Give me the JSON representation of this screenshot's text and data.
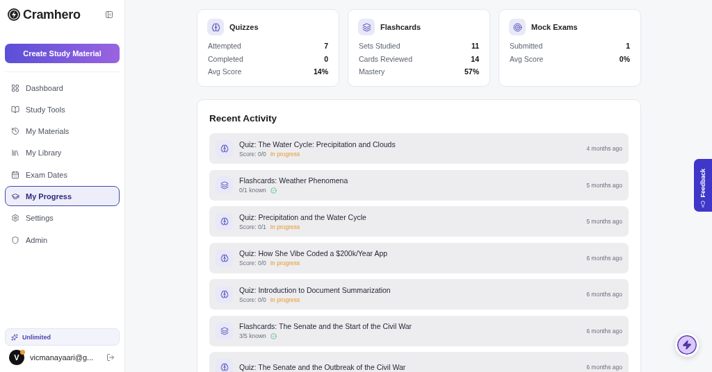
{
  "sidebar": {
    "brand": "Cramhero",
    "create_button": "Create Study Material",
    "items": [
      {
        "label": "Dashboard",
        "selected": false
      },
      {
        "label": "Study Tools",
        "selected": false
      },
      {
        "label": "My Materials",
        "selected": false
      },
      {
        "label": "My Library",
        "selected": false
      },
      {
        "label": "Exam Dates",
        "selected": false
      },
      {
        "label": "My Progress",
        "selected": true
      },
      {
        "label": "Settings",
        "selected": false
      },
      {
        "label": "Admin",
        "selected": false
      }
    ],
    "plan": "Unlimited",
    "user": {
      "initial": "V",
      "email": "vicmanayaari@g..."
    }
  },
  "stats": [
    {
      "kind": "quiz",
      "title": "Quizzes",
      "rows": [
        {
          "label": "Attempted",
          "value": "7"
        },
        {
          "label": "Completed",
          "value": "0"
        },
        {
          "label": "Avg Score",
          "value": "14%"
        }
      ]
    },
    {
      "kind": "flashcards",
      "title": "Flashcards",
      "rows": [
        {
          "label": "Sets Studied",
          "value": "11"
        },
        {
          "label": "Cards Reviewed",
          "value": "14"
        },
        {
          "label": "Mastery",
          "value": "57%"
        }
      ]
    },
    {
      "kind": "exam",
      "title": "Mock Exams",
      "rows": [
        {
          "label": "Submitted",
          "value": "1"
        },
        {
          "label": "Avg Score",
          "value": "0%"
        }
      ]
    }
  ],
  "recent_activity": {
    "title": "Recent Activity",
    "items": [
      {
        "kind": "quiz",
        "title": "Quiz: The Water Cycle: Precipitation and Clouds",
        "detail": "Score: 0/0",
        "status": "In progress",
        "time": "4 months ago"
      },
      {
        "kind": "flashcards",
        "title": "Flashcards: Weather Phenomena",
        "detail": "0/1 known",
        "time": "5 months ago"
      },
      {
        "kind": "quiz",
        "title": "Quiz: Precipitation and the Water Cycle",
        "detail": "Score: 0/1",
        "status": "In progress",
        "time": "5 months ago"
      },
      {
        "kind": "quiz",
        "title": "Quiz: How She Vibe Coded a $200k/Year App",
        "detail": "Score: 0/0",
        "status": "In progress",
        "time": "6 months ago"
      },
      {
        "kind": "quiz",
        "title": "Quiz: Introduction to Document Summarization",
        "detail": "Score: 0/0",
        "status": "In progress",
        "time": "6 months ago"
      },
      {
        "kind": "flashcards",
        "title": "Flashcards: The Senate and the Start of the Civil War",
        "detail": "3/5 known",
        "time": "6 months ago"
      },
      {
        "kind": "quiz",
        "title": "Quiz: The Senate and the Outbreak of the Civil War",
        "time": "6 months ago"
      }
    ]
  },
  "feedback_tab": "Feedback"
}
